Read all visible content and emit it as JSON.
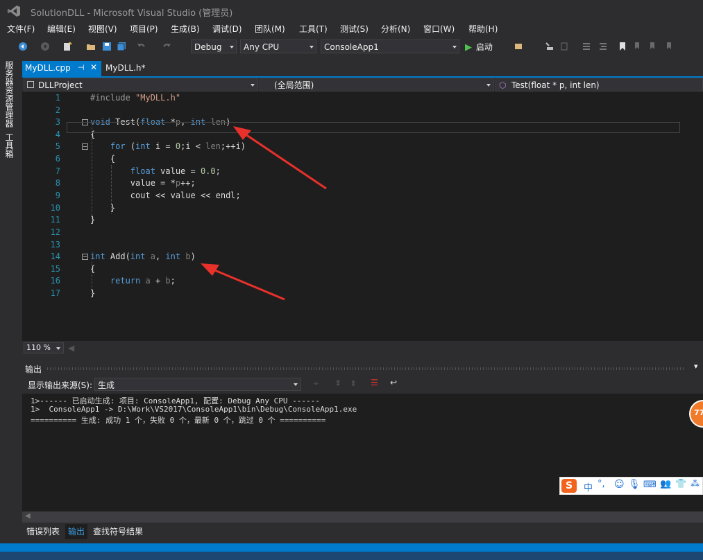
{
  "window": {
    "title": "SolutionDLL - Microsoft Visual Studio (管理员)"
  },
  "menu": [
    "文件(F)",
    "编辑(E)",
    "视图(V)",
    "项目(P)",
    "生成(B)",
    "调试(D)",
    "团队(M)",
    "工具(T)",
    "测试(S)",
    "分析(N)",
    "窗口(W)",
    "帮助(H)"
  ],
  "toolbar": {
    "config": "Debug",
    "platform": "Any CPU",
    "startup_project": "ConsoleApp1",
    "start_label": "启动"
  },
  "sidebar": {
    "tab1": "服务器资源管理器",
    "tab2": "工具箱"
  },
  "tabs": {
    "active": "MyDLL.cpp",
    "other": "MyDLL.h*"
  },
  "navbar": {
    "project": "DLLProject",
    "scope": "(全局范围)",
    "member": "Test(float * p, int len)"
  },
  "editor": {
    "line_numbers": [
      "1",
      "2",
      "3",
      "4",
      "5",
      "6",
      "7",
      "8",
      "9",
      "10",
      "11",
      "12",
      "13",
      "14",
      "15",
      "16",
      "17"
    ]
  },
  "zoom": {
    "level": "110 %"
  },
  "output": {
    "title": "输出",
    "source_label": "显示输出来源(S):",
    "source_value": "生成",
    "lines": [
      "1>------ 已启动生成: 项目: ConsoleApp1, 配置: Debug Any CPU ------",
      "1>  ConsoleApp1 -> D:\\Work\\VS2017\\ConsoleApp1\\bin\\Debug\\ConsoleApp1.exe",
      "========== 生成: 成功 1 个，失败 0 个，最新 0 个，跳过 0 个 =========="
    ]
  },
  "bottom_tabs": [
    "错误列表",
    "输出",
    "查找符号结果"
  ],
  "ime": {
    "mode": "中"
  },
  "float_badge": "77",
  "colors": {
    "accent": "#007acc",
    "arrow": "#e8312b"
  }
}
